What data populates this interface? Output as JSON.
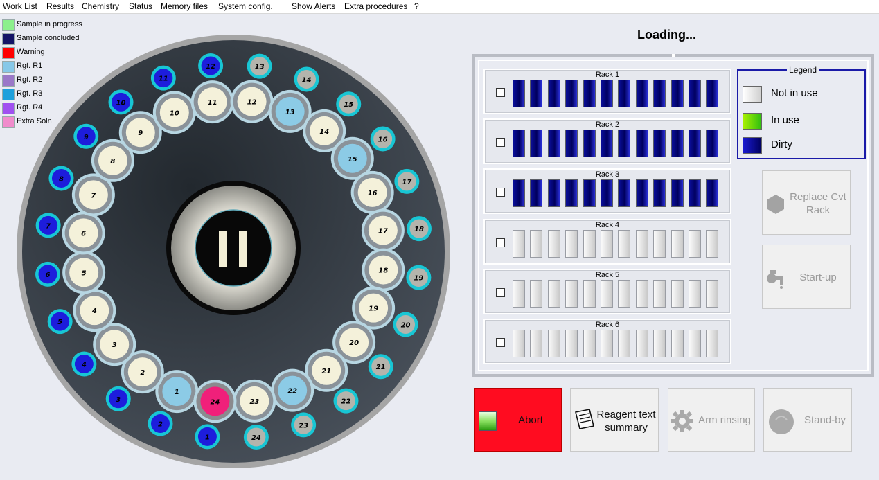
{
  "menu": [
    "Work List",
    "Results",
    "Chemistry",
    "Status",
    "Memory files",
    "System config.",
    "Show Alerts",
    "Extra procedures",
    "?"
  ],
  "status_legend": [
    {
      "label": "Sample in progress",
      "color": "#8cf08c"
    },
    {
      "label": "Sample concluded",
      "color": "#141466"
    },
    {
      "label": "Warning",
      "color": "#ff0000"
    },
    {
      "label": "Rgt. R1",
      "color": "#87c8e8"
    },
    {
      "label": "Rgt. R2",
      "color": "#9a78c8"
    },
    {
      "label": "Rgt. R3",
      "color": "#1ea0dc"
    },
    {
      "label": "Rgt. R4",
      "color": "#a050f0"
    },
    {
      "label": "Extra Soln",
      "color": "#f08ccc"
    }
  ],
  "loading_title": "Loading...",
  "racks": [
    {
      "title": "Rack 1",
      "state": "dirty"
    },
    {
      "title": "Rack 2",
      "state": "dirty"
    },
    {
      "title": "Rack 3",
      "state": "dirty"
    },
    {
      "title": "Rack 4",
      "state": "empty"
    },
    {
      "title": "Rack 5",
      "state": "empty"
    },
    {
      "title": "Rack 6",
      "state": "empty"
    }
  ],
  "legend": {
    "title": "Legend",
    "items": [
      {
        "label": "Not in use",
        "color": "#dcdcdc"
      },
      {
        "label": "In use",
        "color": "#60d020"
      },
      {
        "label": "Dirty",
        "color": "#000080"
      }
    ]
  },
  "buttons": {
    "replace_line1": "Replace Cvt",
    "replace_line2": "Rack",
    "startup": "Start-up",
    "abort": "Abort",
    "reagent_line1": "Reagent text",
    "reagent_line2": "summary",
    "arm_rinsing": "Arm rinsing",
    "standby": "Stand-by"
  },
  "carousel": {
    "center_state": "paused",
    "outer_ring": [
      {
        "label": "1",
        "type": "blue"
      },
      {
        "label": "2",
        "type": "blue"
      },
      {
        "label": "3",
        "type": "blue"
      },
      {
        "label": "4",
        "type": "blue"
      },
      {
        "label": "5",
        "type": "blue"
      },
      {
        "label": "6",
        "type": "blue"
      },
      {
        "label": "7",
        "type": "blue"
      },
      {
        "label": "8",
        "type": "blue"
      },
      {
        "label": "9",
        "type": "blue"
      },
      {
        "label": "10",
        "type": "blue"
      },
      {
        "label": "11",
        "type": "blue"
      },
      {
        "label": "12",
        "type": "blue"
      },
      {
        "label": "13",
        "type": "gray"
      },
      {
        "label": "14",
        "type": "gray"
      },
      {
        "label": "15",
        "type": "gray"
      },
      {
        "label": "16",
        "type": "gray"
      },
      {
        "label": "17",
        "type": "gray"
      },
      {
        "label": "18",
        "type": "gray"
      },
      {
        "label": "19",
        "type": "gray"
      },
      {
        "label": "20",
        "type": "gray"
      },
      {
        "label": "21",
        "type": "gray"
      },
      {
        "label": "22",
        "type": "gray"
      },
      {
        "label": "23",
        "type": "gray"
      },
      {
        "label": "24",
        "type": "gray"
      }
    ],
    "middle_ring": [
      {
        "label": "1",
        "type": "r1"
      },
      {
        "label": "2",
        "type": "empty"
      },
      {
        "label": "3",
        "type": "empty"
      },
      {
        "label": "4",
        "type": "empty"
      },
      {
        "label": "5",
        "type": "empty"
      },
      {
        "label": "6",
        "type": "empty"
      },
      {
        "label": "7",
        "type": "empty"
      },
      {
        "label": "8",
        "type": "empty"
      },
      {
        "label": "9",
        "type": "empty"
      },
      {
        "label": "10",
        "type": "empty"
      },
      {
        "label": "11",
        "type": "empty"
      },
      {
        "label": "12",
        "type": "empty"
      },
      {
        "label": "13",
        "type": "r1"
      },
      {
        "label": "14",
        "type": "empty"
      },
      {
        "label": "15",
        "type": "r1"
      },
      {
        "label": "16",
        "type": "empty"
      },
      {
        "label": "17",
        "type": "empty"
      },
      {
        "label": "18",
        "type": "empty"
      },
      {
        "label": "19",
        "type": "empty"
      },
      {
        "label": "20",
        "type": "empty"
      },
      {
        "label": "21",
        "type": "empty"
      },
      {
        "label": "22",
        "type": "r1"
      },
      {
        "label": "23",
        "type": "empty"
      },
      {
        "label": "24",
        "type": "extra"
      }
    ]
  }
}
